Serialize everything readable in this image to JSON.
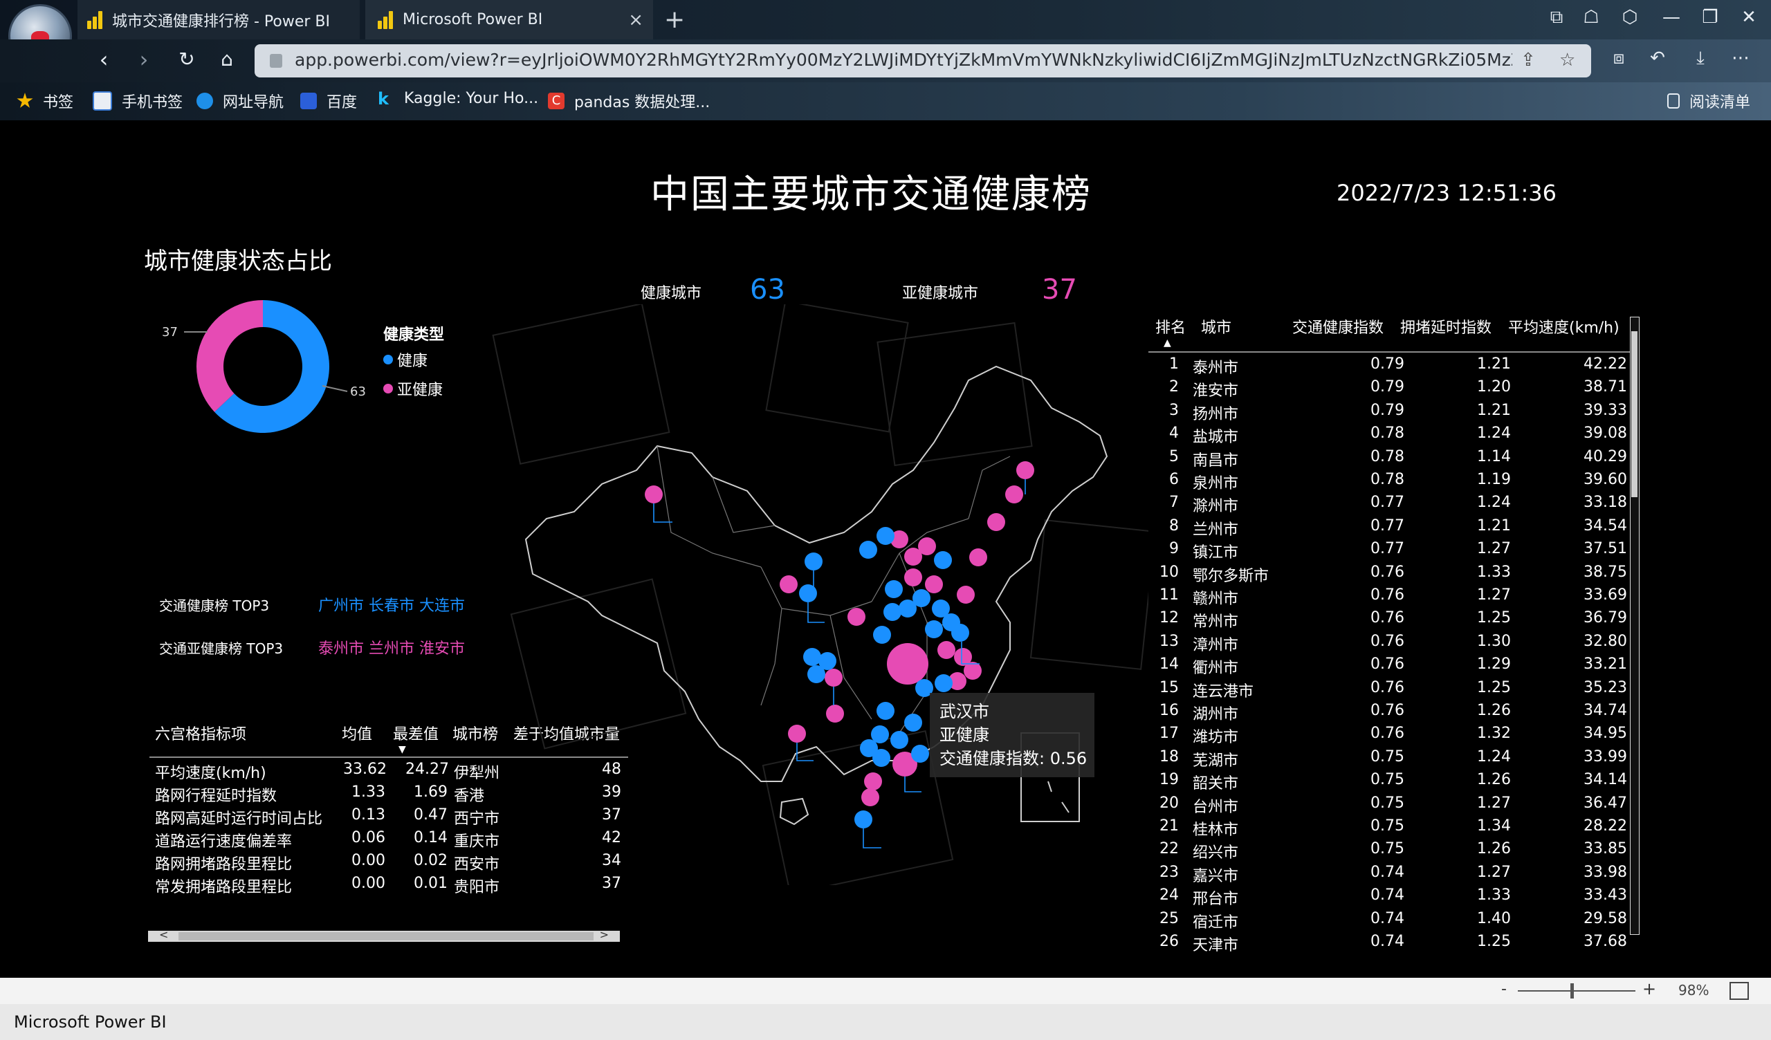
{
  "browser": {
    "tabs": [
      {
        "label": "城市交通健康排行榜 - Power BI",
        "active": false
      },
      {
        "label": "Microsoft Power BI",
        "active": true
      }
    ],
    "url": "app.powerbi.com/view?r=eyJrljoiOWM0Y2RhMGYtY2RmYy00MzY2LWJiMDYtYjZkMmVmYWNkNzkyliwidCI6IjZmMGJiNzJmLTUzNzctNGRkZi05MzZ...",
    "bookmarks": [
      "书签",
      "手机书签",
      "网址导航",
      "百度",
      "Kaggle: Your Ho...",
      "pandas 数据处理..."
    ],
    "reading_list": "阅读清单"
  },
  "report": {
    "title": "中国主要城市交通健康榜",
    "timestamp": "2022/7/23 12:51:36",
    "donut": {
      "title": "城市健康状态占比",
      "legend_title": "健康类型",
      "slices": [
        {
          "label": "健康",
          "value": 63,
          "color": "#1a90ff"
        },
        {
          "label": "亚健康",
          "value": 37,
          "color": "#e64bb4"
        }
      ],
      "label_healthy": "63",
      "label_subhealthy": "37"
    },
    "kpis": {
      "healthy_label": "健康城市",
      "healthy_value": "63",
      "subhealthy_label": "亚健康城市",
      "subhealthy_value": "37"
    },
    "top3": {
      "healthy_label": "交通健康榜 TOP3",
      "healthy_value": "广州市 长春市 大连市",
      "subhealthy_label": "交通亚健康榜 TOP3",
      "subhealthy_value": "泰州市 兰州市 淮安市"
    },
    "hex_table": {
      "headers": [
        "六宫格指标项",
        "均值",
        "最差值",
        "城市榜",
        "差于均值城市量"
      ],
      "rows": [
        [
          "平均速度(km/h)",
          "33.62",
          "24.27",
          "伊犁州",
          "48"
        ],
        [
          "路网行程延时指数",
          "1.33",
          "1.69",
          "香港",
          "39"
        ],
        [
          "路网高延时运行时间占比",
          "0.13",
          "0.47",
          "西宁市",
          "37"
        ],
        [
          "道路运行速度偏差率",
          "0.06",
          "0.14",
          "重庆市",
          "42"
        ],
        [
          "路网拥堵路段里程比",
          "0.00",
          "0.02",
          "西安市",
          "34"
        ],
        [
          "常发拥堵路段里程比",
          "0.00",
          "0.01",
          "贵阳市",
          "37"
        ]
      ]
    },
    "tooltip": {
      "city": "武汉市",
      "status": "亚健康",
      "metric": "交通健康指数: 0.56"
    },
    "rank_table": {
      "headers": [
        "排名",
        "城市",
        "交通健康指数",
        "拥堵延时指数",
        "平均速度(km/h)"
      ],
      "rows": [
        [
          "1",
          "泰州市",
          "0.79",
          "1.21",
          "42.22"
        ],
        [
          "2",
          "淮安市",
          "0.79",
          "1.20",
          "38.71"
        ],
        [
          "3",
          "扬州市",
          "0.79",
          "1.21",
          "39.33"
        ],
        [
          "4",
          "盐城市",
          "0.78",
          "1.24",
          "39.08"
        ],
        [
          "5",
          "南昌市",
          "0.78",
          "1.14",
          "40.29"
        ],
        [
          "6",
          "泉州市",
          "0.78",
          "1.19",
          "39.60"
        ],
        [
          "7",
          "滁州市",
          "0.77",
          "1.24",
          "33.18"
        ],
        [
          "8",
          "兰州市",
          "0.77",
          "1.21",
          "34.54"
        ],
        [
          "9",
          "镇江市",
          "0.77",
          "1.27",
          "37.51"
        ],
        [
          "10",
          "鄂尔多斯市",
          "0.76",
          "1.33",
          "38.75"
        ],
        [
          "11",
          "赣州市",
          "0.76",
          "1.27",
          "33.69"
        ],
        [
          "12",
          "常州市",
          "0.76",
          "1.25",
          "36.79"
        ],
        [
          "13",
          "漳州市",
          "0.76",
          "1.30",
          "32.80"
        ],
        [
          "14",
          "衢州市",
          "0.76",
          "1.29",
          "33.21"
        ],
        [
          "15",
          "连云港市",
          "0.76",
          "1.25",
          "35.23"
        ],
        [
          "16",
          "湖州市",
          "0.76",
          "1.26",
          "34.74"
        ],
        [
          "17",
          "潍坊市",
          "0.76",
          "1.32",
          "34.95"
        ],
        [
          "18",
          "芜湖市",
          "0.75",
          "1.24",
          "33.99"
        ],
        [
          "19",
          "韶关市",
          "0.75",
          "1.26",
          "34.14"
        ],
        [
          "20",
          "台州市",
          "0.75",
          "1.27",
          "36.47"
        ],
        [
          "21",
          "桂林市",
          "0.75",
          "1.34",
          "28.22"
        ],
        [
          "22",
          "绍兴市",
          "0.75",
          "1.26",
          "33.85"
        ],
        [
          "23",
          "嘉兴市",
          "0.74",
          "1.27",
          "33.98"
        ],
        [
          "24",
          "邢台市",
          "0.74",
          "1.33",
          "33.43"
        ],
        [
          "25",
          "宿迁市",
          "0.74",
          "1.40",
          "29.58"
        ],
        [
          "26",
          "天津市",
          "0.74",
          "1.25",
          "37.68"
        ]
      ]
    }
  },
  "statusbar": {
    "zoom_minus": "-",
    "zoom_plus": "+",
    "zoom": "98%"
  },
  "app_title": "Microsoft Power BI",
  "colors": {
    "healthy": "#1a90ff",
    "subhealthy": "#e64bb4"
  }
}
